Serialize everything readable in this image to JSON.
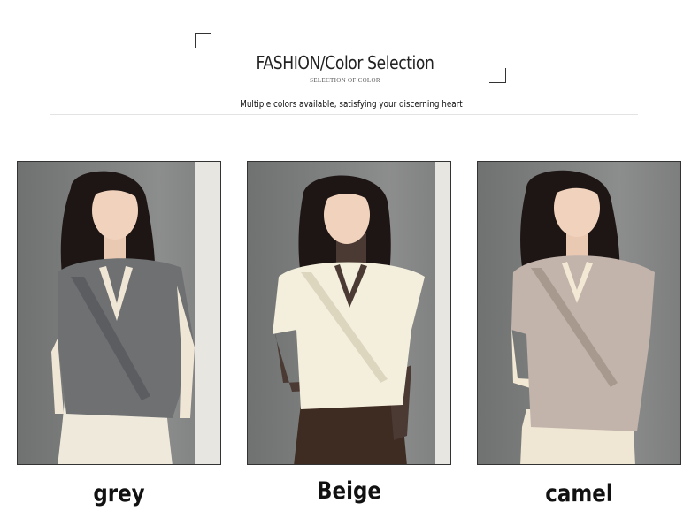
{
  "header": {
    "title": "FASHION/Color Selection",
    "subtitle": "SELECTION OF COLOR",
    "tagline": "Multiple colors available, satisfying your discerning heart"
  },
  "colors": [
    {
      "label": "grey",
      "sweater_color": "#6e7072",
      "sweater_shade": "#5b5d60",
      "inner_color": "#efe6d6",
      "bottom_color": "#efe9dc"
    },
    {
      "label": "Beige",
      "sweater_color": "#f4efdc",
      "sweater_shade": "#ddd6bf",
      "inner_color": "#4a3a33",
      "bottom_color": "#3e2b22"
    },
    {
      "label": "camel",
      "sweater_color": "#c2b3ab",
      "sweater_shade": "#a8998f",
      "inner_color": "#f2e8d4",
      "bottom_color": "#efe6d3"
    }
  ]
}
